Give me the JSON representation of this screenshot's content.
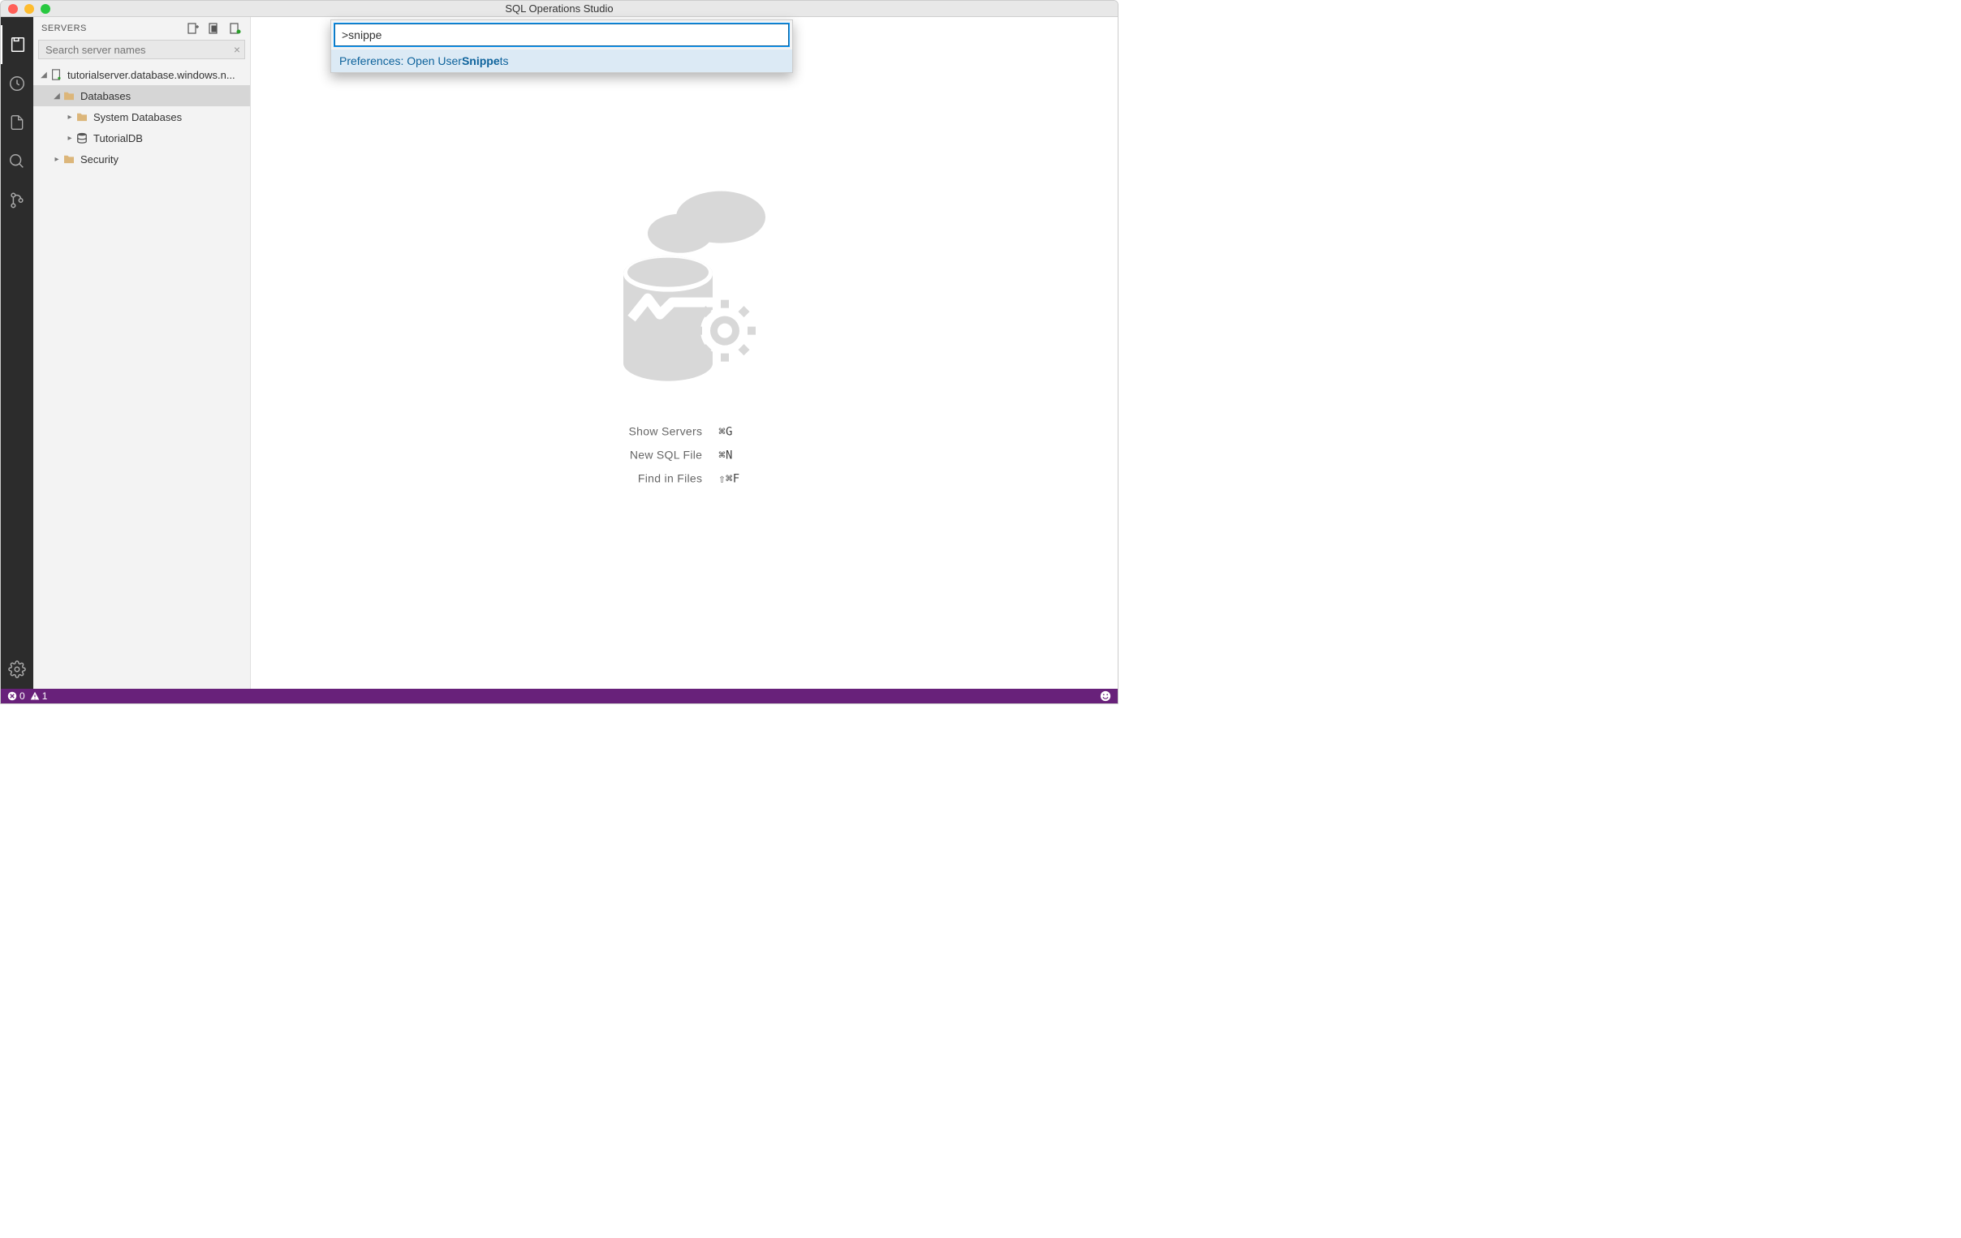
{
  "title": "SQL Operations Studio",
  "sidebar": {
    "title": "SERVERS",
    "search_placeholder": "Search server names",
    "tree": {
      "server": "tutorialserver.database.windows.n...",
      "databases": "Databases",
      "system_db": "System Databases",
      "tutorial_db": "TutorialDB",
      "security": "Security"
    }
  },
  "palette": {
    "input_value": ">snippe",
    "item_prefix": "Preferences: Open User ",
    "item_match": "Snippe",
    "item_suffix": "ts"
  },
  "welcome": {
    "hints": [
      {
        "label": "Show Servers",
        "key": "⌘G"
      },
      {
        "label": "New SQL File",
        "key": "⌘N"
      },
      {
        "label": "Find in Files",
        "key": "⇧⌘F"
      }
    ]
  },
  "status": {
    "errors": "0",
    "warnings": "1"
  }
}
